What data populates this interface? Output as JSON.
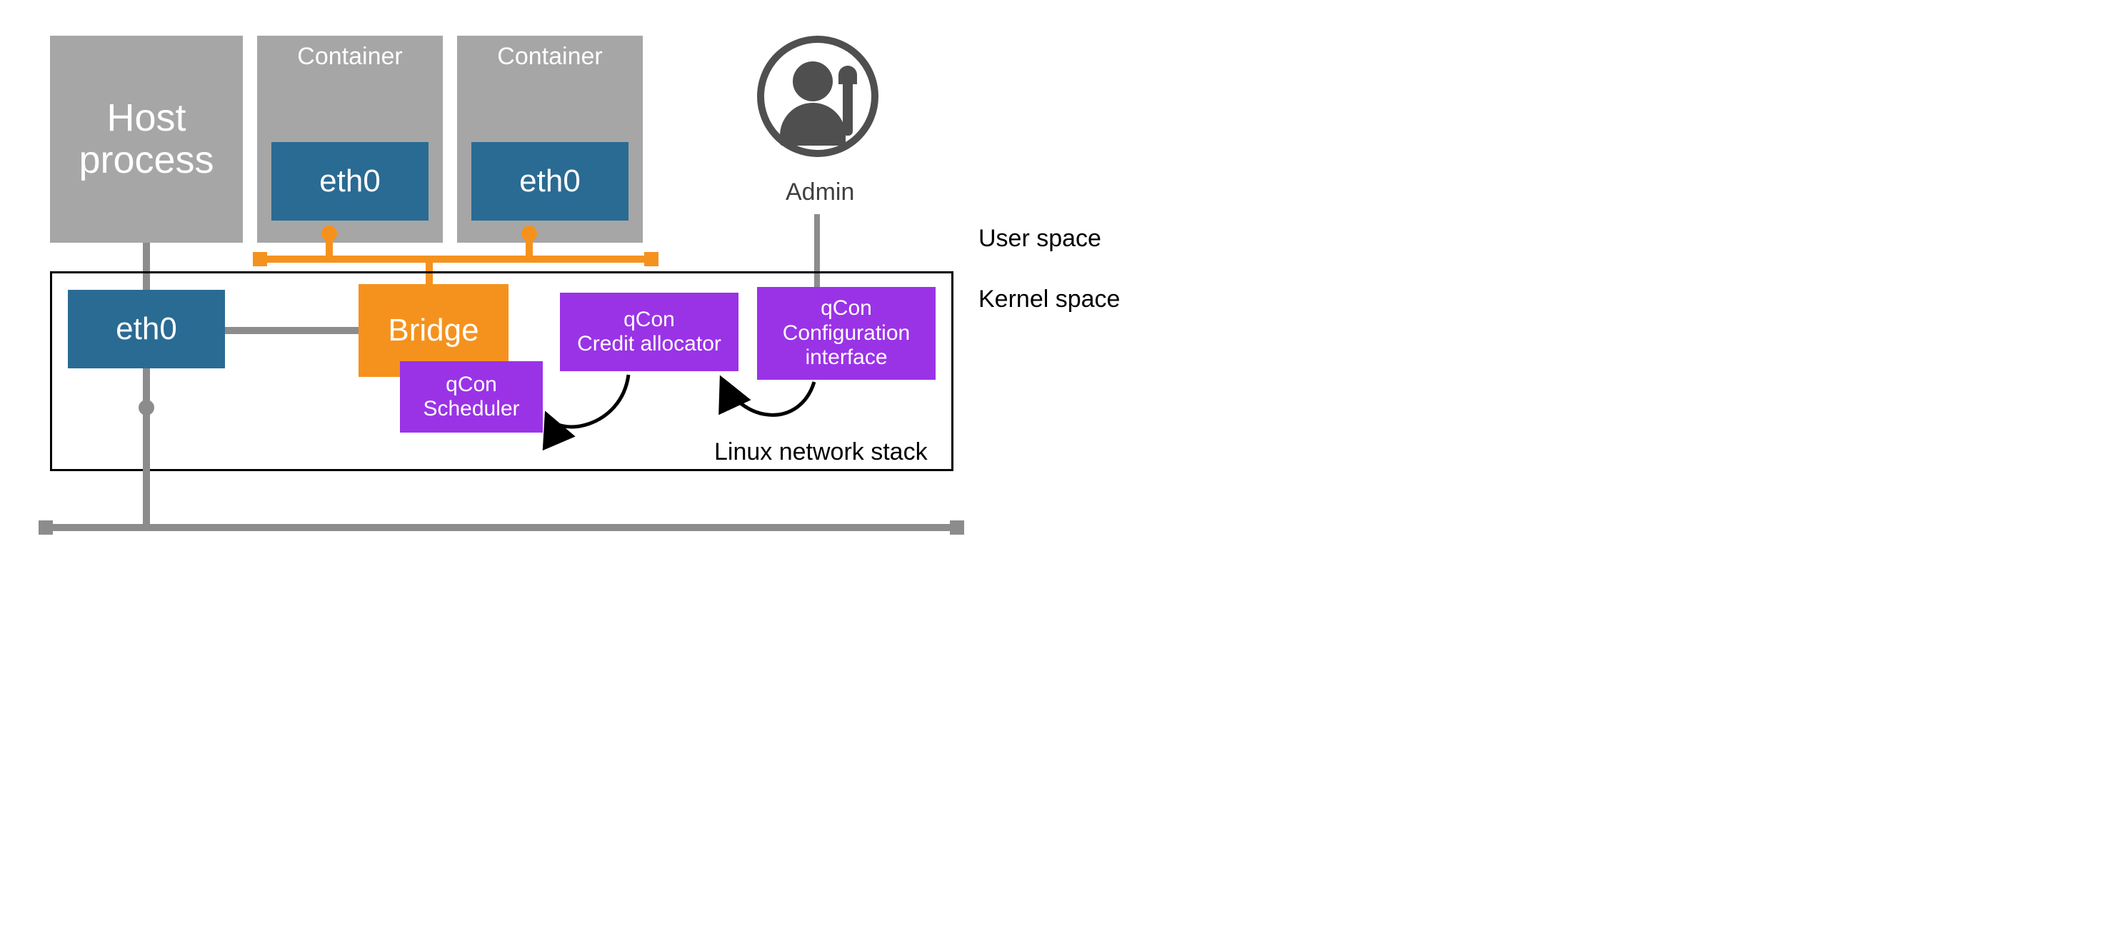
{
  "userspace": {
    "host_process_label": "Host\nprocess",
    "containers": [
      {
        "title": "Container",
        "iface": "eth0"
      },
      {
        "title": "Container",
        "iface": "eth0"
      }
    ],
    "admin_label": "Admin"
  },
  "kernelstack": {
    "eth0_label": "eth0",
    "bridge_label": "Bridge",
    "scheduler_label": "qCon\nScheduler",
    "allocator_label": "qCon\nCredit allocator",
    "config_label": "qCon\nConfiguration\ninterface",
    "stack_title": "Linux network stack"
  },
  "side_labels": {
    "user_space": "User space",
    "kernel_space": "Kernel space"
  },
  "colors": {
    "grey": "#a6a6a6",
    "blue": "#2a6b93",
    "orange": "#f5921e",
    "purple": "#9a33e6",
    "bus_grey": "#8c8c8c"
  }
}
